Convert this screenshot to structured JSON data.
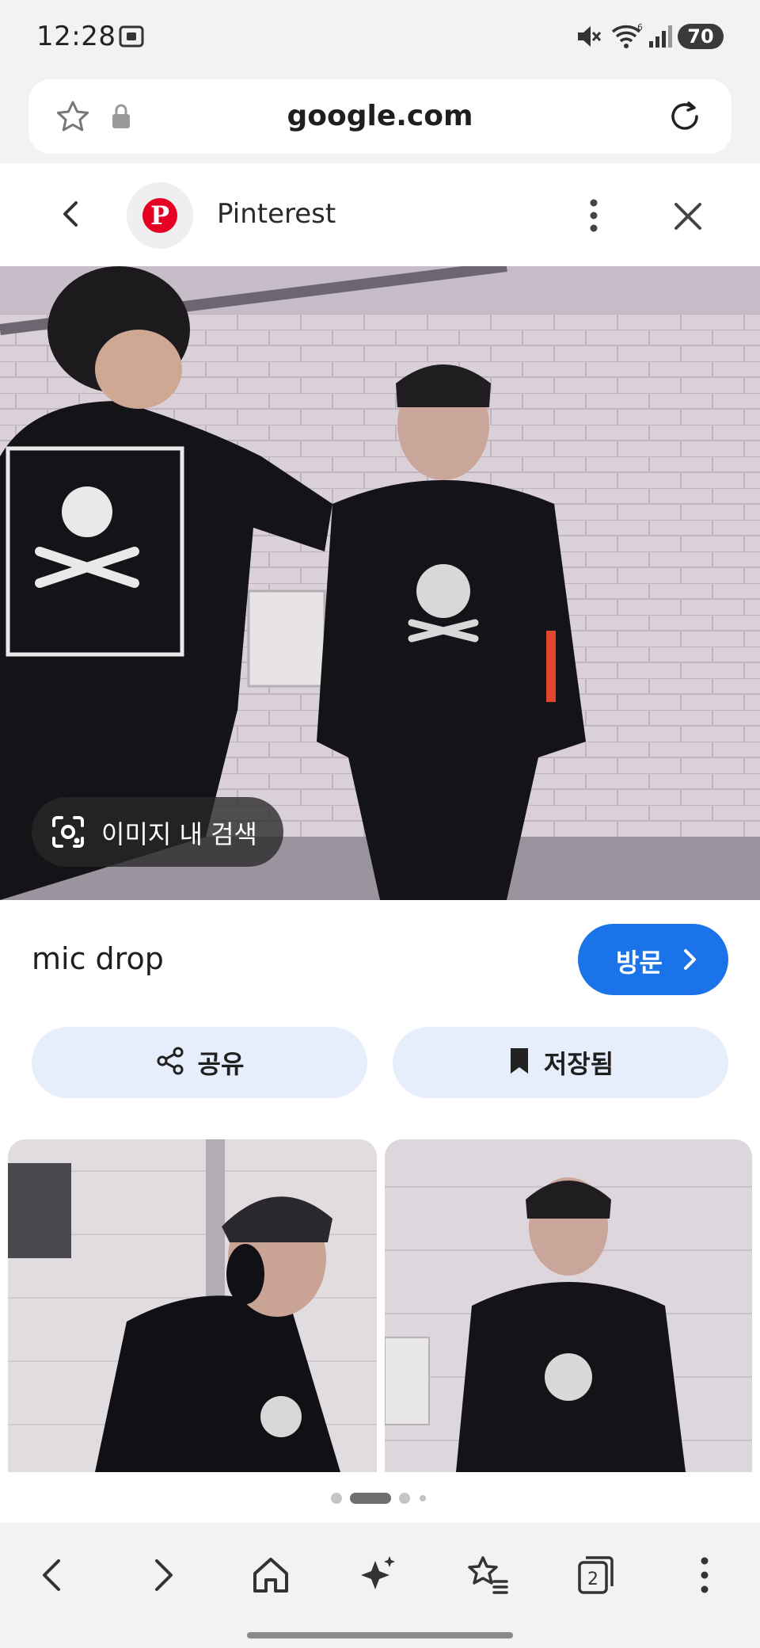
{
  "status_bar": {
    "time": "12:28",
    "battery": "70"
  },
  "browser": {
    "url": "google.com"
  },
  "site_header": {
    "site_name": "Pinterest",
    "logo_letter": "P",
    "brand_color": "#e60023"
  },
  "image_viewer": {
    "lens_label": "이미지 내 검색"
  },
  "result": {
    "title": "mic drop",
    "visit_label": "방문"
  },
  "actions": {
    "share_label": "공유",
    "saved_label": "저장됨"
  },
  "bottom_nav": {
    "tab_count": "2"
  },
  "colors": {
    "accent": "#1a73e8",
    "chip_bg": "#e7eefb"
  }
}
